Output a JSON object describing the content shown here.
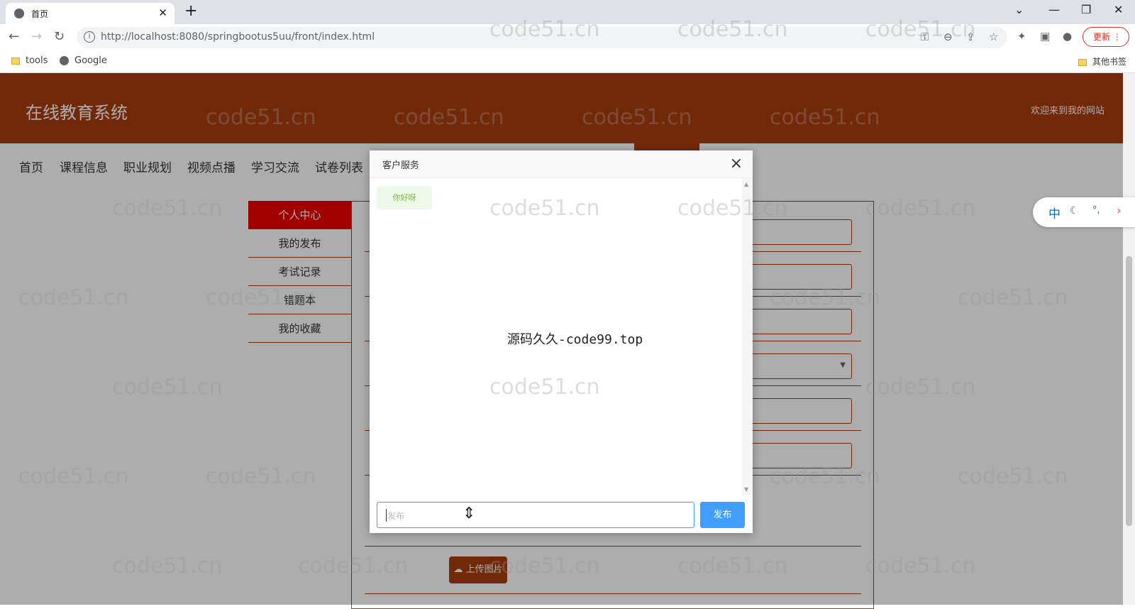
{
  "browser": {
    "tab_title": "首页",
    "url": "http://localhost:8080/springbootus5uu/front/index.html",
    "update_label": "更新",
    "bookmarks": [
      "tools",
      "Google"
    ],
    "other_bookmarks": "其他书签"
  },
  "site": {
    "logo": "在线教育系统",
    "welcome": "欢迎来到我的网站",
    "menu": [
      "首页",
      "课程信息",
      "职业规划",
      "视频点播",
      "学习交流",
      "试卷列表"
    ],
    "sidebar": [
      "个人中心",
      "我的发布",
      "考试记录",
      "错题本",
      "我的收藏"
    ],
    "upload_label": "上传图片"
  },
  "dialog": {
    "title": "客户服务",
    "close": "×",
    "message": "你好呀",
    "center_text": "源码久久-code99.top",
    "input_placeholder": "发布",
    "send_label": "发布"
  },
  "langbar": {
    "label": "中"
  },
  "watermark": "code51.cn"
}
